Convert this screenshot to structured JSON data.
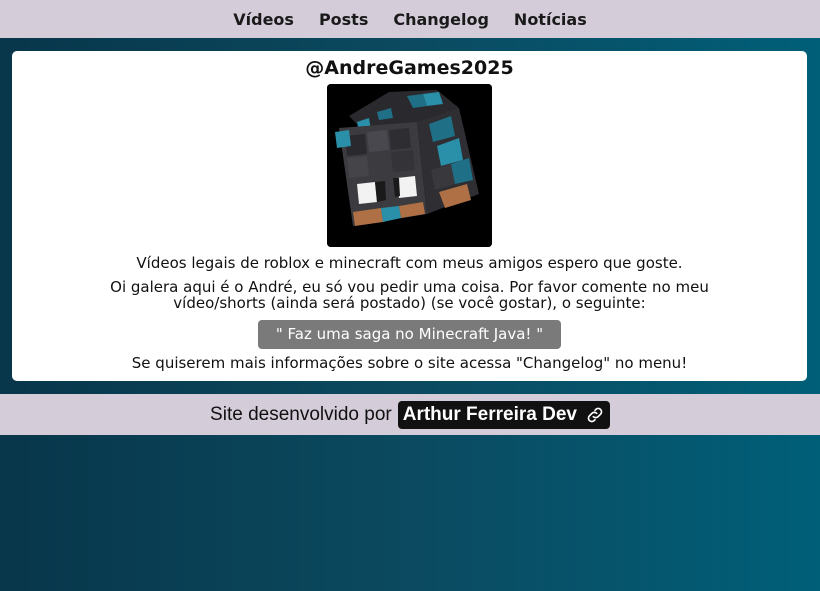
{
  "nav": {
    "items": [
      {
        "label": "Vídeos"
      },
      {
        "label": "Posts"
      },
      {
        "label": "Changelog"
      },
      {
        "label": "Notícias"
      }
    ]
  },
  "profile": {
    "handle": "@AndreGames2025",
    "avatar_icon": "minecraft-head-avatar",
    "description": "Vídeos legais de roblox e minecraft com meus amigos espero que goste.",
    "message": "Oi galera aqui é o André, eu só vou pedir uma coisa. Por favor comente no meu vídeo/shorts (ainda será postado) (se você gostar), o seguinte:",
    "quote": "\" Faz uma saga no Minecraft Java! \"",
    "info": "Se quiserem mais informações sobre o site acessa \"Changelog\" no menu!"
  },
  "footer": {
    "prefix": "Site desenvolvido por",
    "dev_name": "Arthur Ferreira Dev",
    "link_icon": "link-icon"
  },
  "colors": {
    "bar_bg": "#d4ccd9",
    "card_bg": "#ffffff",
    "quote_bg": "#7a7a7a",
    "dev_bg": "#111111"
  }
}
